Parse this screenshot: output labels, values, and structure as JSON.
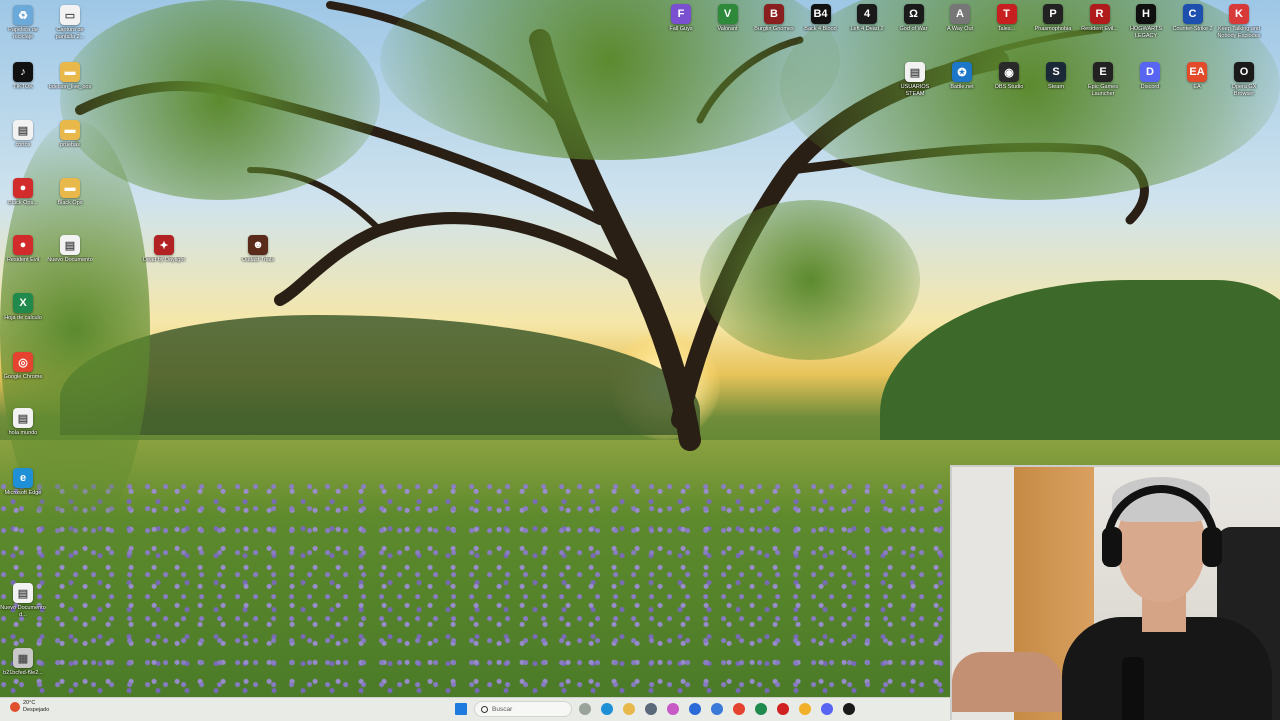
{
  "desktop_icons": [
    {
      "id": "recycle",
      "label": "Papelera de reciclaje",
      "color": "#6aa9d8",
      "glyph": "♻"
    },
    {
      "id": "capture",
      "label": "Captura de pantalla 2...",
      "color": "#f2f2f2",
      "glyph": "▭"
    },
    {
      "id": "tiktok",
      "label": "TIKTOK",
      "color": "#111111",
      "glyph": "♪"
    },
    {
      "id": "folder1",
      "label": "bdelson_live_bos",
      "color": "#e8b94a",
      "glyph": "▬"
    },
    {
      "id": "doc1",
      "label": "cortos",
      "color": "#f2f2f2",
      "glyph": "▤"
    },
    {
      "id": "folder2",
      "label": "pruebas",
      "color": "#e8b94a",
      "glyph": "▬"
    },
    {
      "id": "game1",
      "label": "Black Ops...",
      "color": "#d12b2b",
      "glyph": "●"
    },
    {
      "id": "folder3",
      "label": "Black Ops",
      "color": "#e8b94a",
      "glyph": "▬"
    },
    {
      "id": "game2",
      "label": "Resident Evil",
      "color": "#d12b2b",
      "glyph": "●"
    },
    {
      "id": "doc2",
      "label": "Nuevo Documento",
      "color": "#f2f2f2",
      "glyph": "▤"
    },
    {
      "id": "excel",
      "label": "Hoja de calculo",
      "color": "#1f8a4c",
      "glyph": "X"
    },
    {
      "id": "chrome",
      "label": "Google Chrome",
      "color": "#e5432f",
      "glyph": "◎"
    },
    {
      "id": "doc3",
      "label": "hola mundo",
      "color": "#f2f2f2",
      "glyph": "▤"
    },
    {
      "id": "edge",
      "label": "Microsoft Edge",
      "color": "#1f8fd6",
      "glyph": "e"
    },
    {
      "id": "doc4",
      "label": "Nuevo Documento d...",
      "color": "#f2f2f2",
      "glyph": "▤"
    },
    {
      "id": "file1",
      "label": "b21bcfed-f9e2...",
      "color": "#c8c8c8",
      "glyph": "▦"
    },
    {
      "id": "game3",
      "label": "Dead by Daylight",
      "color": "#b32222",
      "glyph": "✦"
    },
    {
      "id": "game4",
      "label": "Outlast Trials",
      "color": "#5a2a1a",
      "glyph": "☻"
    }
  ],
  "top_icons_row1": [
    {
      "label": "Fall Guys",
      "color": "#7a4fd0",
      "glyph": "F"
    },
    {
      "label": "Valorant",
      "color": "#2e8a3a",
      "glyph": "V"
    },
    {
      "label": "Burglin Gnomes",
      "color": "#8a1f1f",
      "glyph": "B"
    },
    {
      "label": "Back 4 Blood",
      "color": "#111111",
      "glyph": "B4"
    },
    {
      "label": "Left 4 Dead 2",
      "color": "#1a1a1a",
      "glyph": "4"
    },
    {
      "label": "God of War",
      "color": "#1a1a1a",
      "glyph": "Ω"
    },
    {
      "label": "A Way Out",
      "color": "#777777",
      "glyph": "A"
    },
    {
      "label": "Tales...",
      "color": "#c82020",
      "glyph": "T"
    },
    {
      "label": "Phasmophobia",
      "color": "#222222",
      "glyph": "P"
    },
    {
      "label": "Resident Evil...",
      "color": "#b01c1c",
      "glyph": "R"
    },
    {
      "label": "HOGWARTS LEGACY",
      "color": "#101010",
      "glyph": "H"
    },
    {
      "label": "Counter-Strike 2",
      "color": "#1d4fae",
      "glyph": "C"
    },
    {
      "label": "Keep Talking and Nobody Explodes",
      "color": "#d83a3a",
      "glyph": "K"
    }
  ],
  "top_icons_row2": [
    {
      "label": "USUARIOS STEAM",
      "color": "#f2f2f2",
      "glyph": "▤"
    },
    {
      "label": "Battle.net",
      "color": "#1d77c9",
      "glyph": "✪"
    },
    {
      "label": "OBS Studio",
      "color": "#2a2a2a",
      "glyph": "◉"
    },
    {
      "label": "Steam",
      "color": "#1b2838",
      "glyph": "S"
    },
    {
      "label": "Epic Games Launcher",
      "color": "#222222",
      "glyph": "E"
    },
    {
      "label": "Discord",
      "color": "#5865f2",
      "glyph": "D"
    },
    {
      "label": "EA",
      "color": "#e24a2a",
      "glyph": "EA"
    },
    {
      "label": "Opera GX Browser",
      "color": "#1a1a1a",
      "glyph": "O"
    }
  ],
  "taskbar": {
    "weather_temp": "20°C",
    "weather_desc": "Despejado",
    "search_placeholder": "Buscar",
    "apps": [
      {
        "name": "windows-start",
        "color": "#1f7ae0"
      },
      {
        "name": "widgets",
        "color": "#9aa39a"
      },
      {
        "name": "edge",
        "color": "#1f8fd6"
      },
      {
        "name": "file-explorer",
        "color": "#e8b94a"
      },
      {
        "name": "calculator",
        "color": "#5a6a7a"
      },
      {
        "name": "copilot",
        "color": "#c85ac8"
      },
      {
        "name": "mail",
        "color": "#2a6ad8"
      },
      {
        "name": "store",
        "color": "#3a7ad8"
      },
      {
        "name": "chrome",
        "color": "#e5432f"
      },
      {
        "name": "excel",
        "color": "#1f8a4c"
      },
      {
        "name": "opera",
        "color": "#d02020"
      },
      {
        "name": "chrome-2",
        "color": "#f2b02a"
      },
      {
        "name": "discord",
        "color": "#5865f2"
      },
      {
        "name": "app-extra",
        "color": "#1a1a1a"
      }
    ]
  }
}
